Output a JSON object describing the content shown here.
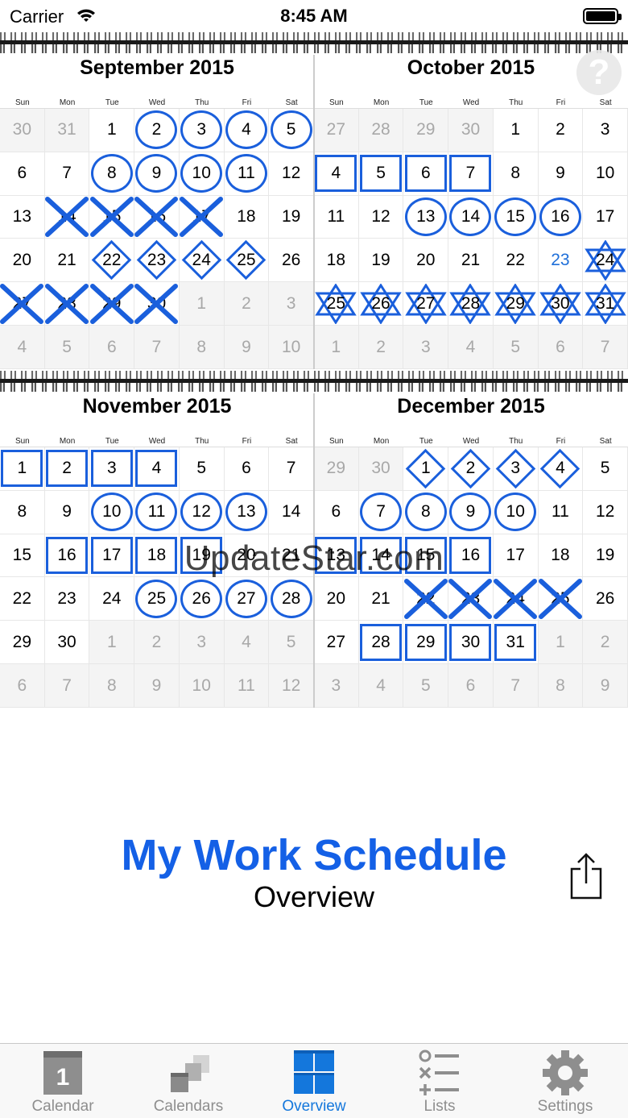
{
  "status_bar": {
    "carrier": "Carrier",
    "time": "8:45 AM"
  },
  "weekday_labels": [
    "Sun",
    "Mon",
    "Tue",
    "Wed",
    "Thu",
    "Fri",
    "Sat"
  ],
  "months": [
    {
      "title": "September 2015",
      "days": [
        {
          "n": "30",
          "out": true
        },
        {
          "n": "31",
          "out": true
        },
        {
          "n": "1"
        },
        {
          "n": "2",
          "m": "circle"
        },
        {
          "n": "3",
          "m": "circle"
        },
        {
          "n": "4",
          "m": "circle"
        },
        {
          "n": "5",
          "m": "circle"
        },
        {
          "n": "6"
        },
        {
          "n": "7"
        },
        {
          "n": "8",
          "m": "circle"
        },
        {
          "n": "9",
          "m": "circle"
        },
        {
          "n": "10",
          "m": "circle"
        },
        {
          "n": "11",
          "m": "circle"
        },
        {
          "n": "12"
        },
        {
          "n": "13"
        },
        {
          "n": "14",
          "m": "x"
        },
        {
          "n": "15",
          "m": "x"
        },
        {
          "n": "16",
          "m": "x"
        },
        {
          "n": "17",
          "m": "x"
        },
        {
          "n": "18"
        },
        {
          "n": "19"
        },
        {
          "n": "20"
        },
        {
          "n": "21"
        },
        {
          "n": "22",
          "m": "diamond"
        },
        {
          "n": "23",
          "m": "diamond"
        },
        {
          "n": "24",
          "m": "diamond"
        },
        {
          "n": "25",
          "m": "diamond"
        },
        {
          "n": "26"
        },
        {
          "n": "27",
          "m": "x"
        },
        {
          "n": "28",
          "m": "x"
        },
        {
          "n": "29",
          "m": "x"
        },
        {
          "n": "30",
          "m": "x"
        },
        {
          "n": "1",
          "out": true
        },
        {
          "n": "2",
          "out": true
        },
        {
          "n": "3",
          "out": true
        },
        {
          "n": "4",
          "out": true
        },
        {
          "n": "5",
          "out": true
        },
        {
          "n": "6",
          "out": true
        },
        {
          "n": "7",
          "out": true
        },
        {
          "n": "8",
          "out": true
        },
        {
          "n": "9",
          "out": true
        },
        {
          "n": "10",
          "out": true
        }
      ]
    },
    {
      "title": "October 2015",
      "days": [
        {
          "n": "27",
          "out": true
        },
        {
          "n": "28",
          "out": true
        },
        {
          "n": "29",
          "out": true
        },
        {
          "n": "30",
          "out": true
        },
        {
          "n": "1"
        },
        {
          "n": "2"
        },
        {
          "n": "3"
        },
        {
          "n": "4",
          "m": "square"
        },
        {
          "n": "5",
          "m": "square"
        },
        {
          "n": "6",
          "m": "square"
        },
        {
          "n": "7",
          "m": "square"
        },
        {
          "n": "8"
        },
        {
          "n": "9"
        },
        {
          "n": "10"
        },
        {
          "n": "11"
        },
        {
          "n": "12"
        },
        {
          "n": "13",
          "m": "circle"
        },
        {
          "n": "14",
          "m": "circle"
        },
        {
          "n": "15",
          "m": "circle"
        },
        {
          "n": "16",
          "m": "circle"
        },
        {
          "n": "17"
        },
        {
          "n": "18"
        },
        {
          "n": "19"
        },
        {
          "n": "20"
        },
        {
          "n": "21"
        },
        {
          "n": "22"
        },
        {
          "n": "23",
          "today": true
        },
        {
          "n": "24",
          "m": "star"
        },
        {
          "n": "25",
          "m": "star"
        },
        {
          "n": "26",
          "m": "star"
        },
        {
          "n": "27",
          "m": "star"
        },
        {
          "n": "28",
          "m": "star"
        },
        {
          "n": "29",
          "m": "star"
        },
        {
          "n": "30",
          "m": "star"
        },
        {
          "n": "31",
          "m": "star"
        },
        {
          "n": "1",
          "out": true
        },
        {
          "n": "2",
          "out": true
        },
        {
          "n": "3",
          "out": true
        },
        {
          "n": "4",
          "out": true
        },
        {
          "n": "5",
          "out": true
        },
        {
          "n": "6",
          "out": true
        },
        {
          "n": "7",
          "out": true
        }
      ]
    },
    {
      "title": "November 2015",
      "days": [
        {
          "n": "1",
          "m": "square"
        },
        {
          "n": "2",
          "m": "square"
        },
        {
          "n": "3",
          "m": "square"
        },
        {
          "n": "4",
          "m": "square"
        },
        {
          "n": "5"
        },
        {
          "n": "6"
        },
        {
          "n": "7"
        },
        {
          "n": "8"
        },
        {
          "n": "9"
        },
        {
          "n": "10",
          "m": "circle"
        },
        {
          "n": "11",
          "m": "circle"
        },
        {
          "n": "12",
          "m": "circle"
        },
        {
          "n": "13",
          "m": "circle"
        },
        {
          "n": "14"
        },
        {
          "n": "15"
        },
        {
          "n": "16",
          "m": "square"
        },
        {
          "n": "17",
          "m": "square"
        },
        {
          "n": "18",
          "m": "square"
        },
        {
          "n": "19",
          "m": "square"
        },
        {
          "n": "20"
        },
        {
          "n": "21"
        },
        {
          "n": "22"
        },
        {
          "n": "23"
        },
        {
          "n": "24"
        },
        {
          "n": "25",
          "m": "circle"
        },
        {
          "n": "26",
          "m": "circle"
        },
        {
          "n": "27",
          "m": "circle"
        },
        {
          "n": "28",
          "m": "circle"
        },
        {
          "n": "29"
        },
        {
          "n": "30"
        },
        {
          "n": "1",
          "out": true
        },
        {
          "n": "2",
          "out": true
        },
        {
          "n": "3",
          "out": true
        },
        {
          "n": "4",
          "out": true
        },
        {
          "n": "5",
          "out": true
        },
        {
          "n": "6",
          "out": true
        },
        {
          "n": "7",
          "out": true
        },
        {
          "n": "8",
          "out": true
        },
        {
          "n": "9",
          "out": true
        },
        {
          "n": "10",
          "out": true
        },
        {
          "n": "11",
          "out": true
        },
        {
          "n": "12",
          "out": true
        }
      ]
    },
    {
      "title": "December 2015",
      "days": [
        {
          "n": "29",
          "out": true
        },
        {
          "n": "30",
          "out": true
        },
        {
          "n": "1",
          "m": "diamond"
        },
        {
          "n": "2",
          "m": "diamond"
        },
        {
          "n": "3",
          "m": "diamond"
        },
        {
          "n": "4",
          "m": "diamond"
        },
        {
          "n": "5"
        },
        {
          "n": "6"
        },
        {
          "n": "7",
          "m": "circle"
        },
        {
          "n": "8",
          "m": "circle"
        },
        {
          "n": "9",
          "m": "circle"
        },
        {
          "n": "10",
          "m": "circle"
        },
        {
          "n": "11"
        },
        {
          "n": "12"
        },
        {
          "n": "13",
          "m": "square"
        },
        {
          "n": "14",
          "m": "square"
        },
        {
          "n": "15",
          "m": "square"
        },
        {
          "n": "16",
          "m": "square"
        },
        {
          "n": "17"
        },
        {
          "n": "18"
        },
        {
          "n": "19"
        },
        {
          "n": "20"
        },
        {
          "n": "21"
        },
        {
          "n": "22",
          "m": "x"
        },
        {
          "n": "23",
          "m": "x"
        },
        {
          "n": "24",
          "m": "x"
        },
        {
          "n": "25",
          "m": "x"
        },
        {
          "n": "26"
        },
        {
          "n": "27"
        },
        {
          "n": "28",
          "m": "square"
        },
        {
          "n": "29",
          "m": "square"
        },
        {
          "n": "30",
          "m": "square"
        },
        {
          "n": "31",
          "m": "square"
        },
        {
          "n": "1",
          "out": true
        },
        {
          "n": "2",
          "out": true
        },
        {
          "n": "3",
          "out": true
        },
        {
          "n": "4",
          "out": true
        },
        {
          "n": "5",
          "out": true
        },
        {
          "n": "6",
          "out": true
        },
        {
          "n": "7",
          "out": true
        },
        {
          "n": "8",
          "out": true
        },
        {
          "n": "9",
          "out": true
        }
      ]
    }
  ],
  "help_glyph": "?",
  "watermark": "UpdateStar.com",
  "overview": {
    "title": "My Work Schedule",
    "subtitle": "Overview"
  },
  "tabs": [
    {
      "label": "Calendar",
      "icon": "calendar-icon",
      "active": false,
      "badge": "1"
    },
    {
      "label": "Calendars",
      "icon": "calendars-stack-icon",
      "active": false
    },
    {
      "label": "Overview",
      "icon": "overview-grid-icon",
      "active": true
    },
    {
      "label": "Lists",
      "icon": "lists-icon",
      "active": false
    },
    {
      "label": "Settings",
      "icon": "gear-icon",
      "active": false
    }
  ],
  "colors": {
    "accent": "#1460e6",
    "marker": "#1a5fdc",
    "tab_active": "#1477dc",
    "tab_inactive": "#8e8e8e",
    "today": "#1e6fd9"
  }
}
